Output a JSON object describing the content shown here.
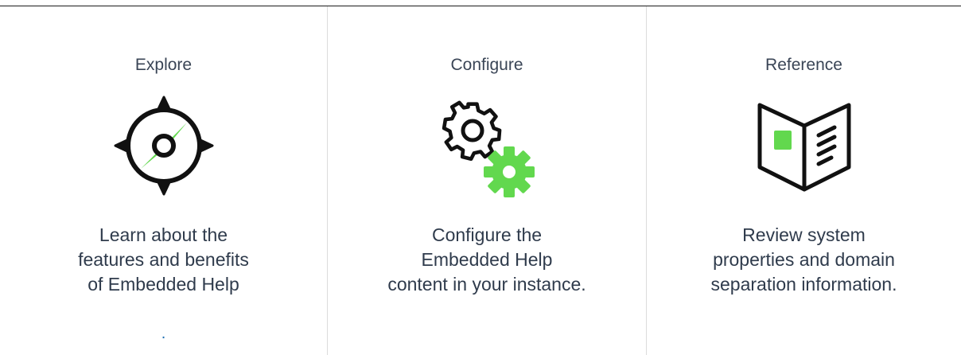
{
  "colors": {
    "accent": "#62d84e",
    "icon_stroke": "#111111",
    "text": "#2f3b4c",
    "divider": "#dcdcdc",
    "dot": "#1f6fb2"
  },
  "cards": [
    {
      "title": "Explore",
      "icon": "compass-icon",
      "description_lines": [
        "Learn about the",
        "features and benefits",
        "of Embedded Help"
      ],
      "dot": "."
    },
    {
      "title": "Configure",
      "icon": "gears-icon",
      "description_lines": [
        "Configure the",
        "Embedded Help",
        "content in your instance."
      ]
    },
    {
      "title": "Reference",
      "icon": "open-book-icon",
      "description_lines": [
        "Review system",
        "properties and domain",
        "separation information."
      ]
    }
  ]
}
